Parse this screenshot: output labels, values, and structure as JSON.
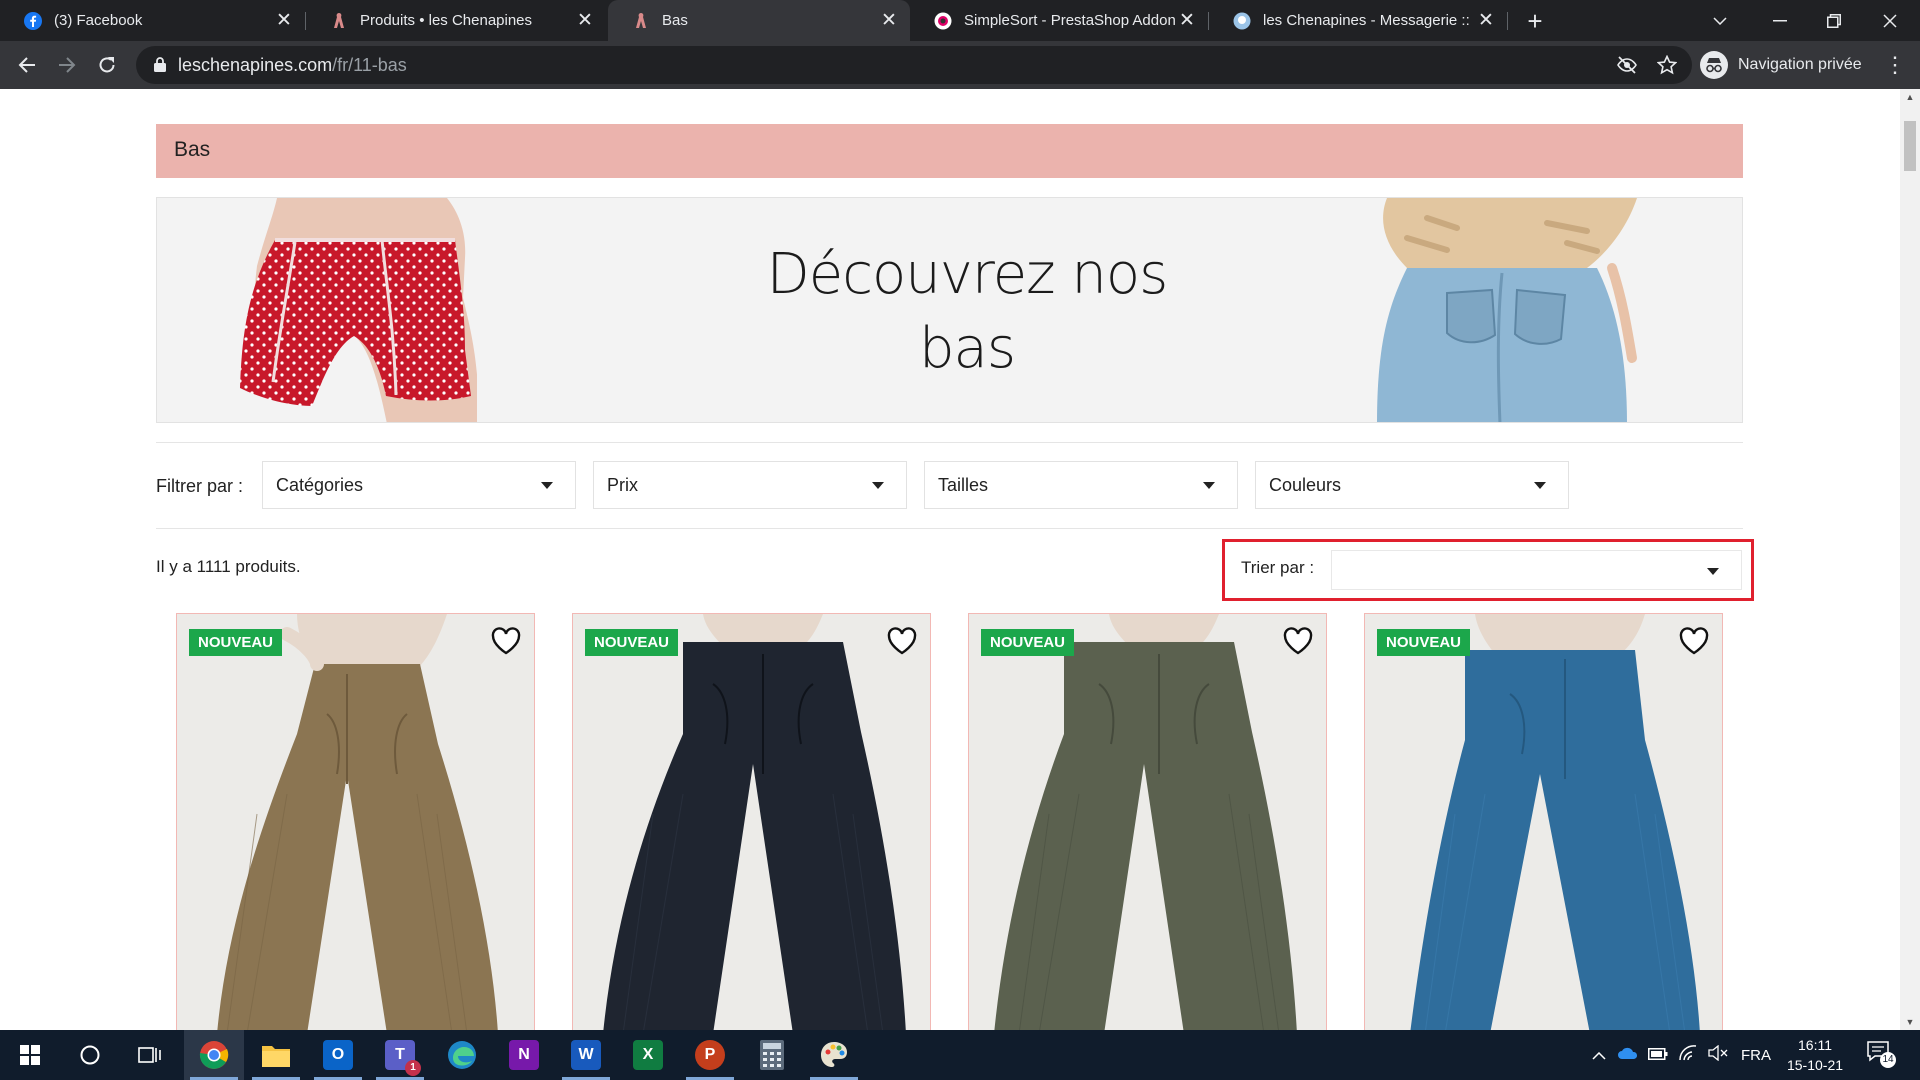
{
  "browser": {
    "tabs": [
      {
        "title": "(3) Facebook",
        "icon": "facebook-icon",
        "active": false
      },
      {
        "title": "Produits • les Chenapines",
        "icon": "chenapines-icon",
        "active": false
      },
      {
        "title": "Bas",
        "icon": "chenapines-icon",
        "active": true
      },
      {
        "title": "SimpleSort - PrestaShop Addons",
        "icon": "prestashop-icon",
        "active": false
      },
      {
        "title": "les Chenapines - Messagerie :: Bo",
        "icon": "prestashop-icon",
        "active": false
      }
    ],
    "url_domain": "leschenapines.com",
    "url_path": "/fr/11-bas",
    "incognito_label": "Navigation privée"
  },
  "page": {
    "category_title": "Bas",
    "banner_text_line1": "Découvrez nos",
    "banner_text_line2": "bas",
    "filter_label": "Filtrer par :",
    "filters": [
      "Catégories",
      "Prix",
      "Tailles",
      "Couleurs"
    ],
    "product_count": "Il y a 1111 produits.",
    "sort_label": "Trier par :",
    "sort_value": "",
    "products": [
      {
        "badge": "NOUVEAU",
        "color": "#8b7552"
      },
      {
        "badge": "NOUVEAU",
        "color": "#1f2530"
      },
      {
        "badge": "NOUVEAU",
        "color": "#5b614f"
      },
      {
        "badge": "NOUVEAU",
        "color": "#2f6d9c"
      }
    ],
    "colors": {
      "header_bg": "#ebb3ad",
      "badge_bg": "#1ca74b",
      "highlight": "#e0202e"
    }
  },
  "taskbar": {
    "apps": [
      "windows-start-icon",
      "search-circle-icon",
      "task-view-icon",
      "chrome-icon",
      "file-explorer-icon",
      "outlook-icon",
      "teams-icon",
      "edge-icon",
      "onenote-icon",
      "word-icon",
      "excel-icon",
      "powerpoint-icon",
      "calculator-icon",
      "paint-icon"
    ],
    "language": "FRA",
    "time": "16:11",
    "date": "15-10-21",
    "notifications": "14",
    "teams_badge": "1"
  }
}
